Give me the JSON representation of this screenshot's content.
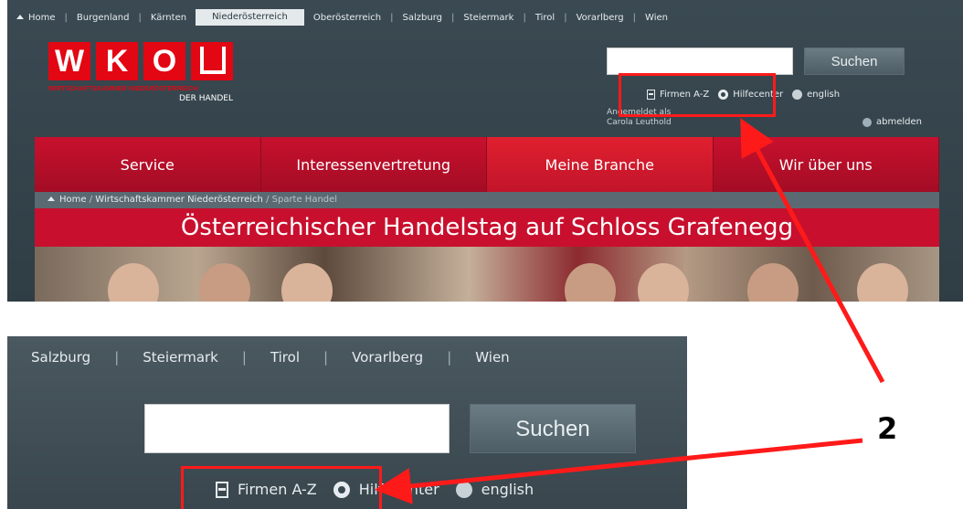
{
  "region_nav": {
    "home": "Home",
    "items": [
      "Burgenland",
      "Kärnten",
      "Niederösterreich",
      "Oberösterreich",
      "Salzburg",
      "Steiermark",
      "Tirol",
      "Vorarlberg",
      "Wien"
    ],
    "active": "Niederösterreich"
  },
  "logo": {
    "letters": [
      "W",
      "K",
      "O"
    ],
    "subtitle": "WIRTSCHAFTSKAMMER NIEDERÖSTERREICH",
    "branch": "DER HANDEL"
  },
  "search": {
    "value": "",
    "button_label": "Suchen"
  },
  "util_links": {
    "firmen": "Firmen A-Z",
    "hilfe": "Hilfecenter",
    "english": "english"
  },
  "user": {
    "logged_label": "Angemeldet als",
    "name": "Carola Leuthold",
    "logout": "abmelden"
  },
  "main_nav": [
    "Service",
    "Interessenvertretung",
    "Meine Branche",
    "Wir über uns"
  ],
  "breadcrumb": {
    "home": "Home",
    "middle": "Wirtschaftskammer Niederösterreich",
    "last": "Sparte Handel"
  },
  "banner": "Österreichischer Handelstag auf Schloss Grafenegg",
  "zoom": {
    "nav": [
      "Salzburg",
      "Steiermark",
      "Tirol",
      "Vorarlberg",
      "Wien"
    ],
    "search_button": "Suchen",
    "firmen": "Firmen A-Z",
    "hilfe": "Hilfecenter",
    "english": "english"
  },
  "marker_label": "2",
  "colors": {
    "accent_red": "#c8102e",
    "annotation_red": "#ff1a1a",
    "dark_bg": "#3b4a52"
  }
}
